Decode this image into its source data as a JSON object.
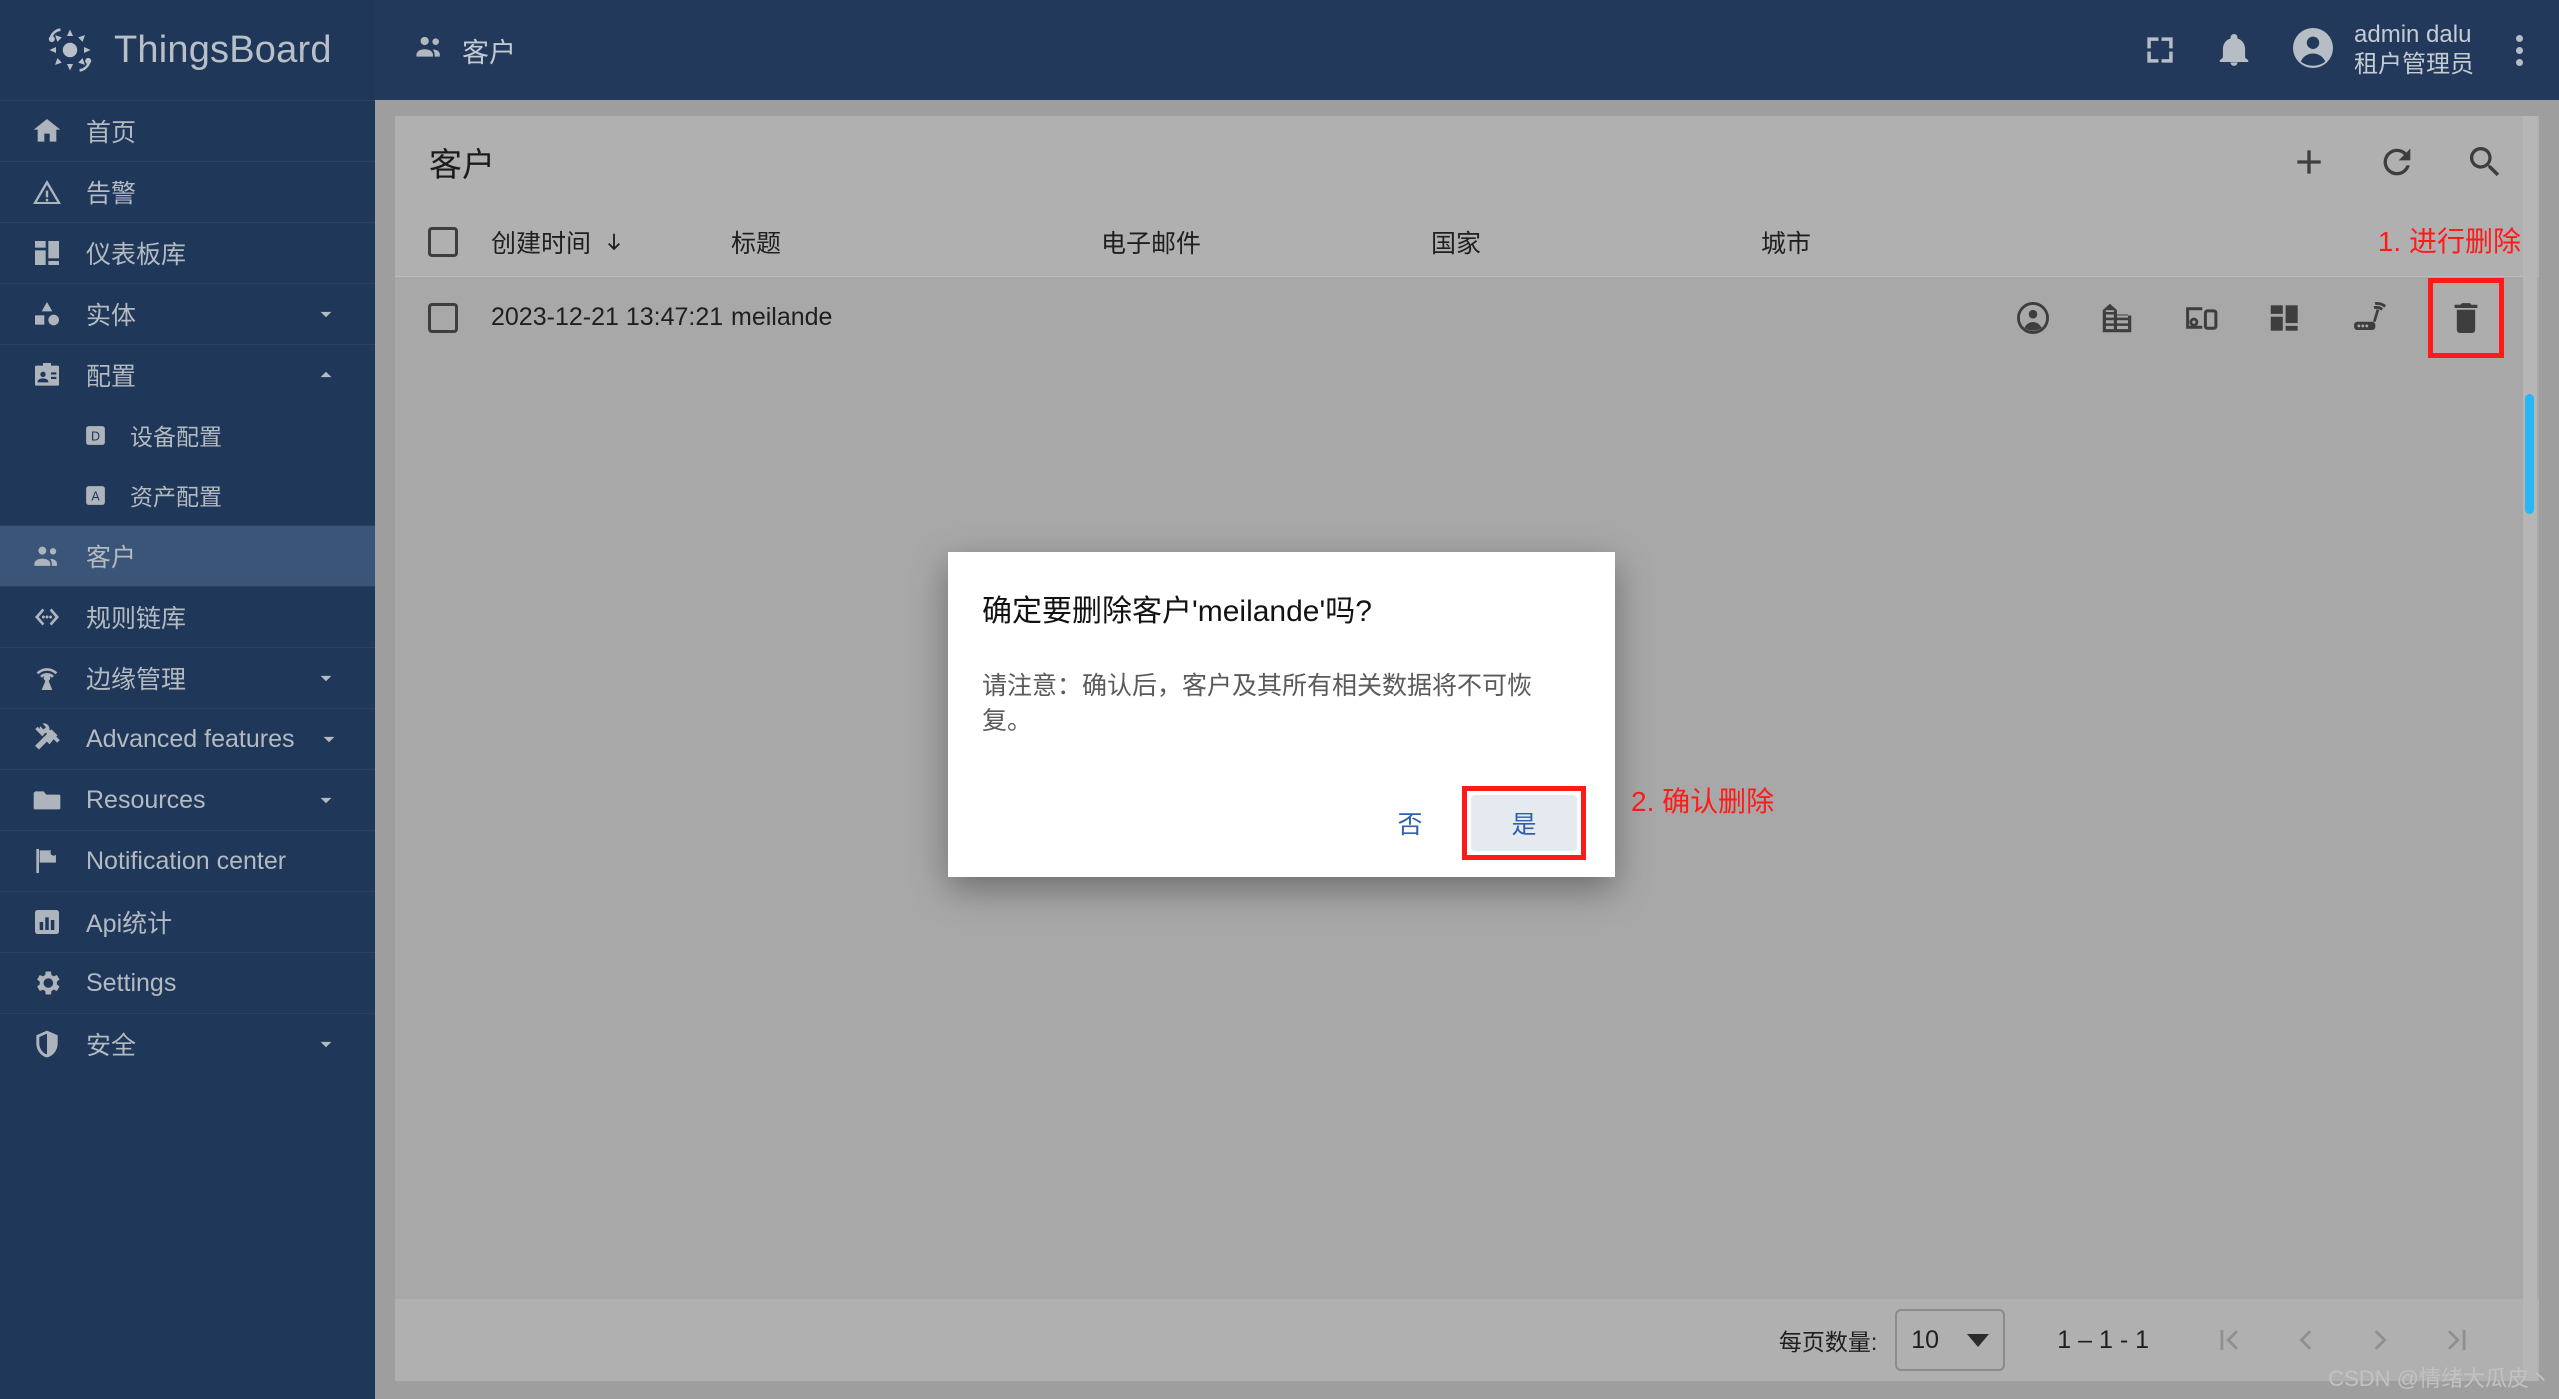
{
  "brand": {
    "title": "ThingsBoard"
  },
  "sidebar": {
    "items": [
      {
        "label": "首页",
        "icon": "home-icon",
        "expandable": false,
        "active": false,
        "sub": false
      },
      {
        "label": "告警",
        "icon": "alarm-warning-icon",
        "expandable": false,
        "active": false,
        "sub": false
      },
      {
        "label": "仪表板库",
        "icon": "dashboard-icon",
        "expandable": false,
        "active": false,
        "sub": false
      },
      {
        "label": "实体",
        "icon": "entities-icon",
        "expandable": true,
        "expanded": false,
        "active": false,
        "sub": false
      },
      {
        "label": "配置",
        "icon": "profile-card-icon",
        "expandable": true,
        "expanded": true,
        "active": false,
        "sub": false
      },
      {
        "label": "设备配置",
        "icon": "device-profile-icon",
        "expandable": false,
        "active": false,
        "sub": true
      },
      {
        "label": "资产配置",
        "icon": "asset-profile-icon",
        "expandable": false,
        "active": false,
        "sub": true
      },
      {
        "label": "客户",
        "icon": "customers-icon",
        "expandable": false,
        "active": true,
        "sub": false
      },
      {
        "label": "规则链库",
        "icon": "rule-chain-icon",
        "expandable": false,
        "active": false,
        "sub": false
      },
      {
        "label": "边缘管理",
        "icon": "edge-icon",
        "expandable": true,
        "expanded": false,
        "active": false,
        "sub": false
      },
      {
        "label": "Advanced features",
        "icon": "tools-icon",
        "expandable": true,
        "expanded": false,
        "active": false,
        "sub": false
      },
      {
        "label": "Resources",
        "icon": "folder-icon",
        "expandable": true,
        "expanded": false,
        "active": false,
        "sub": false
      },
      {
        "label": "Notification center",
        "icon": "flag-icon",
        "expandable": false,
        "active": false,
        "sub": false
      },
      {
        "label": "Api统计",
        "icon": "bar-chart-icon",
        "expandable": false,
        "active": false,
        "sub": false
      },
      {
        "label": "Settings",
        "icon": "gear-icon",
        "expandable": false,
        "active": false,
        "sub": false
      },
      {
        "label": "安全",
        "icon": "shield-icon",
        "expandable": true,
        "expanded": false,
        "active": false,
        "sub": false
      }
    ]
  },
  "topbar": {
    "title": "客户",
    "fullscreen_icon": "fullscreen-icon",
    "notifications_icon": "bell-icon",
    "user_name": "admin dalu",
    "user_role": "租户管理员",
    "menu_icon": "kebab-menu-icon"
  },
  "card": {
    "title": "客户",
    "actions": [
      {
        "name": "add-customer-button",
        "icon": "plus-icon"
      },
      {
        "name": "refresh-button",
        "icon": "refresh-icon"
      },
      {
        "name": "search-button",
        "icon": "search-icon"
      }
    ]
  },
  "table": {
    "columns": [
      "创建时间",
      "标题",
      "电子邮件",
      "国家",
      "城市"
    ],
    "sorted_column": "创建时间",
    "sort_direction": "desc",
    "rows": [
      {
        "created": "2023-12-21 13:47:21",
        "title": "meilande",
        "email": "",
        "country": "",
        "city": "",
        "actions": [
          {
            "name": "manage-users-icon",
            "icon": "user-circle-icon"
          },
          {
            "name": "manage-assets-icon",
            "icon": "building-icon"
          },
          {
            "name": "manage-devices-icon",
            "icon": "devices-icon"
          },
          {
            "name": "manage-dashboards-icon",
            "icon": "dashboard-grid-icon"
          },
          {
            "name": "manage-edges-icon",
            "icon": "router-icon"
          },
          {
            "name": "delete-customer-icon",
            "icon": "trash-icon"
          }
        ]
      }
    ]
  },
  "paginator": {
    "items_per_page_label": "每页数量:",
    "items_per_page_value": "10",
    "range_label": "1 – 1 - 1",
    "first_page_icon": "first-page-icon",
    "prev_page_icon": "prev-page-icon",
    "next_page_icon": "next-page-icon",
    "last_page_icon": "last-page-icon"
  },
  "dialog": {
    "title": "确定要删除客户'meilande'吗?",
    "body": "请注意：确认后，客户及其所有相关数据将不可恢复。",
    "no_label": "否",
    "yes_label": "是"
  },
  "annotations": {
    "step1": "1. 进行删除",
    "step2": "2. 确认删除",
    "highlight_color": "#ff1a1a"
  },
  "watermark": "CSDN @情绪大瓜皮丶"
}
